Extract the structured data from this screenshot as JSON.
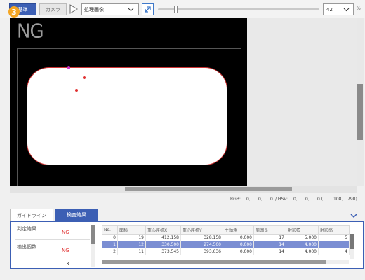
{
  "toolbar": {
    "reference_button": "基準",
    "camera_button": "カメラ",
    "process_select_value": "処理画像",
    "zoom_value": "42",
    "zoom_unit": "%",
    "slider_level_fraction": 0.11
  },
  "badge": "3",
  "viewer": {
    "result_text": "NG"
  },
  "status": {
    "rgb_label": "RGB:",
    "rgb_values": [
      "0,",
      "0,",
      "0"
    ],
    "hsv_label": "/ HSV:",
    "hsv_values": [
      "0,",
      "0,",
      "0 ("
    ],
    "coord_values": [
      "108,",
      "790)"
    ]
  },
  "tabs": {
    "guide": "ガイドライン",
    "result": "検査結果"
  },
  "summary": {
    "judgment_label": "判定結果",
    "judgment_value": "NG",
    "detect_label": "検出個数",
    "detect_value": "NG",
    "detect_count": "3"
  },
  "table": {
    "headers": [
      "No.",
      "面積",
      "重心座標X",
      "重心座標Y",
      "主軸角",
      "周囲長",
      "射影幅",
      "射影高"
    ],
    "rows": [
      [
        "0",
        "19",
        "412.158",
        "328.158",
        "0.000",
        "17",
        "5.000",
        "5"
      ],
      [
        "1",
        "12",
        "330.500",
        "274.500",
        "0.000",
        "14",
        "4.000",
        ""
      ],
      [
        "2",
        "11",
        "373.545",
        "393.636",
        "0.000",
        "14",
        "4.000",
        "4"
      ]
    ],
    "selected_row": 1
  },
  "colors": {
    "accent": "#3c5fb4",
    "ng_red": "#e03030",
    "badge": "#f5a623"
  }
}
